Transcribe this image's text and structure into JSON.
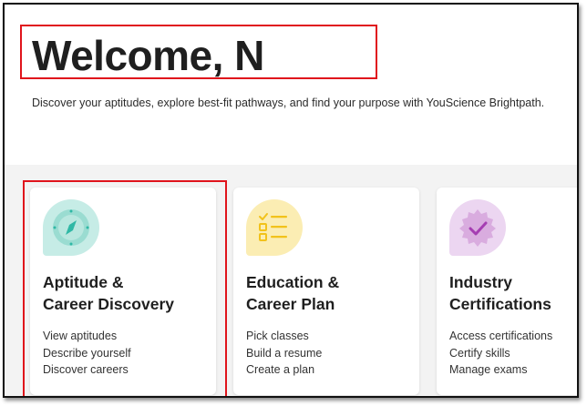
{
  "header": {
    "welcome": "Welcome, N",
    "subtitle": "Discover your aptitudes, explore best-fit pathways, and find your purpose with YouScience Brightpath."
  },
  "cards": [
    {
      "title_line1": "Aptitude &",
      "title_line2": "Career Discovery",
      "icon": "compass-icon",
      "color": "#c6ece6",
      "links": [
        "View aptitudes",
        "Describe yourself",
        "Discover careers"
      ]
    },
    {
      "title_line1": "Education &",
      "title_line2": "Career Plan",
      "icon": "checklist-icon",
      "color": "#fbedb3",
      "links": [
        "Pick classes",
        "Build a resume",
        "Create a plan"
      ]
    },
    {
      "title_line1": "Industry",
      "title_line2": "Certifications",
      "icon": "certificate-badge-icon",
      "color": "#ecd6f1",
      "links": [
        "Access certifications",
        "Certify skills",
        "Manage exams"
      ]
    }
  ],
  "colors": {
    "highlight": "#e0141c",
    "teal": "#2fb8a5",
    "yellow": "#f2c21b",
    "purple": "#a53db2"
  }
}
